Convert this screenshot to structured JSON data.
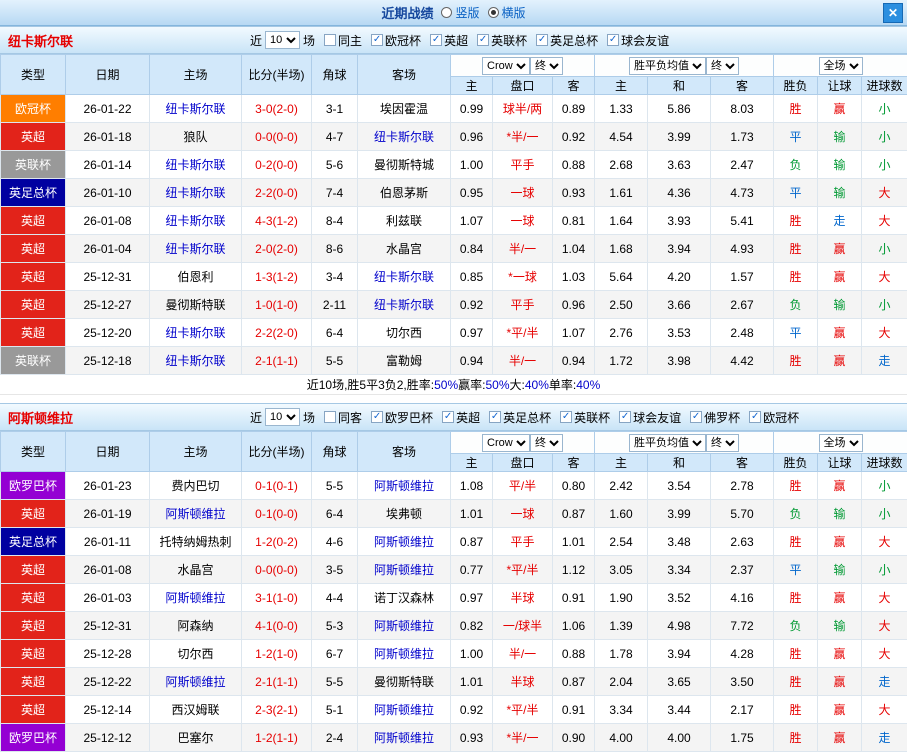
{
  "titlebar": {
    "title": "近期战绩",
    "radios": [
      {
        "label": "竖版",
        "selected": false
      },
      {
        "label": "横版",
        "selected": true
      }
    ],
    "close_label": "✕"
  },
  "header_labels": {
    "type": "类型",
    "date": "日期",
    "home": "主场",
    "score_half": "比分(半场)",
    "corner": "角球",
    "away": "客场",
    "h": "主",
    "handicap": "盘口",
    "a": "客",
    "win": "主",
    "draw": "和",
    "lose": "客",
    "result": "胜负",
    "let": "让球",
    "goals": "进球数"
  },
  "selects": {
    "company": "Crow",
    "final1": "终",
    "avg": "胜平负均值",
    "final2": "终",
    "full": "全场"
  },
  "filter_labels": {
    "near": "近",
    "games": "场"
  },
  "type_colors": {
    "欧冠杯": "#ff7e00",
    "英超": "#e2231a",
    "英联杯": "#999999",
    "英足总杯": "#0000a0",
    "欧罗巴杯": "#9400d3"
  },
  "result_colors": {
    "red": "#e60000",
    "green": "#009933",
    "blue": "#0066cc"
  },
  "result_color_map": {
    "胜": "red",
    "赢": "red",
    "大": "red",
    "负": "green",
    "输": "green",
    "小": "green",
    "平": "blue",
    "走": "blue"
  },
  "sections": [
    {
      "team": "纽卡斯尔联",
      "count": "10",
      "checkboxes": [
        {
          "label": "同主",
          "checked": false
        },
        {
          "label": "欧冠杯",
          "checked": true
        },
        {
          "label": "英超",
          "checked": true
        },
        {
          "label": "英联杯",
          "checked": true
        },
        {
          "label": "英足总杯",
          "checked": true
        },
        {
          "label": "球会友谊",
          "checked": true
        }
      ],
      "rows": [
        {
          "type": "欧冠杯",
          "date": "26-01-22",
          "home": "纽卡斯尔联",
          "score": "3-0(2-0)",
          "corner": "3-1",
          "away": "埃因霍温",
          "oh": "0.99",
          "hc": "球半/两",
          "oa": "0.89",
          "w": "1.33",
          "d": "5.86",
          "l": "8.03",
          "r": "胜",
          "g": "赢",
          "t": "小"
        },
        {
          "type": "英超",
          "date": "26-01-18",
          "home": "狼队",
          "score": "0-0(0-0)",
          "corner": "4-7",
          "away": "纽卡斯尔联",
          "oh": "0.96",
          "hc": "*半/一",
          "oa": "0.92",
          "w": "4.54",
          "d": "3.99",
          "l": "1.73",
          "r": "平",
          "g": "输",
          "t": "小"
        },
        {
          "type": "英联杯",
          "date": "26-01-14",
          "home": "纽卡斯尔联",
          "score": "0-2(0-0)",
          "corner": "5-6",
          "away": "曼彻斯特城",
          "oh": "1.00",
          "hc": "平手",
          "oa": "0.88",
          "w": "2.68",
          "d": "3.63",
          "l": "2.47",
          "r": "负",
          "g": "输",
          "t": "小"
        },
        {
          "type": "英足总杯",
          "date": "26-01-10",
          "home": "纽卡斯尔联",
          "score": "2-2(0-0)",
          "corner": "7-4",
          "away": "伯恩茅斯",
          "oh": "0.95",
          "hc": "一球",
          "oa": "0.93",
          "w": "1.61",
          "d": "4.36",
          "l": "4.73",
          "r": "平",
          "g": "输",
          "t": "大"
        },
        {
          "type": "英超",
          "date": "26-01-08",
          "home": "纽卡斯尔联",
          "score": "4-3(1-2)",
          "corner": "8-4",
          "away": "利兹联",
          "oh": "1.07",
          "hc": "一球",
          "oa": "0.81",
          "w": "1.64",
          "d": "3.93",
          "l": "5.41",
          "r": "胜",
          "g": "走",
          "t": "大"
        },
        {
          "type": "英超",
          "date": "26-01-04",
          "home": "纽卡斯尔联",
          "score": "2-0(2-0)",
          "corner": "8-6",
          "away": "水晶宫",
          "oh": "0.84",
          "hc": "半/一",
          "oa": "1.04",
          "w": "1.68",
          "d": "3.94",
          "l": "4.93",
          "r": "胜",
          "g": "赢",
          "t": "小"
        },
        {
          "type": "英超",
          "date": "25-12-31",
          "home": "伯恩利",
          "score": "1-3(1-2)",
          "corner": "3-4",
          "away": "纽卡斯尔联",
          "oh": "0.85",
          "hc": "*一球",
          "oa": "1.03",
          "w": "5.64",
          "d": "4.20",
          "l": "1.57",
          "r": "胜",
          "g": "赢",
          "t": "大"
        },
        {
          "type": "英超",
          "date": "25-12-27",
          "home": "曼彻斯特联",
          "score": "1-0(1-0)",
          "corner": "2-11",
          "away": "纽卡斯尔联",
          "oh": "0.92",
          "hc": "平手",
          "oa": "0.96",
          "w": "2.50",
          "d": "3.66",
          "l": "2.67",
          "r": "负",
          "g": "输",
          "t": "小"
        },
        {
          "type": "英超",
          "date": "25-12-20",
          "home": "纽卡斯尔联",
          "score": "2-2(2-0)",
          "corner": "6-4",
          "away": "切尔西",
          "oh": "0.97",
          "hc": "*平/半",
          "oa": "1.07",
          "w": "2.76",
          "d": "3.53",
          "l": "2.48",
          "r": "平",
          "g": "赢",
          "t": "大"
        },
        {
          "type": "英联杯",
          "date": "25-12-18",
          "home": "纽卡斯尔联",
          "score": "2-1(1-1)",
          "corner": "5-5",
          "away": "富勒姆",
          "oh": "0.94",
          "hc": "半/一",
          "oa": "0.94",
          "w": "1.72",
          "d": "3.98",
          "l": "4.42",
          "r": "胜",
          "g": "赢",
          "t": "走"
        }
      ],
      "summary": [
        {
          "text": "近10场,胜5平3负2, ",
          "color": "#000000"
        },
        {
          "text": "胜率:",
          "color": "#000000"
        },
        {
          "text": "50%",
          "color": "#0000cc"
        },
        {
          "text": " 赢率:",
          "color": "#000000"
        },
        {
          "text": "50%",
          "color": "#0000cc"
        },
        {
          "text": " 大:",
          "color": "#000000"
        },
        {
          "text": "40%",
          "color": "#0000cc"
        },
        {
          "text": " 单率:",
          "color": "#000000"
        },
        {
          "text": "40%",
          "color": "#0000cc"
        }
      ]
    },
    {
      "team": "阿斯顿维拉",
      "count": "10",
      "checkboxes": [
        {
          "label": "同客",
          "checked": false
        },
        {
          "label": "欧罗巴杯",
          "checked": true
        },
        {
          "label": "英超",
          "checked": true
        },
        {
          "label": "英足总杯",
          "checked": true
        },
        {
          "label": "英联杯",
          "checked": true
        },
        {
          "label": "球会友谊",
          "checked": true
        },
        {
          "label": "佛罗杯",
          "checked": true
        },
        {
          "label": "欧冠杯",
          "checked": true
        }
      ],
      "rows": [
        {
          "type": "欧罗巴杯",
          "date": "26-01-23",
          "home": "费内巴切",
          "score": "0-1(0-1)",
          "corner": "5-5",
          "away": "阿斯顿维拉",
          "oh": "1.08",
          "hc": "平/半",
          "oa": "0.80",
          "w": "2.42",
          "d": "3.54",
          "l": "2.78",
          "r": "胜",
          "g": "赢",
          "t": "小"
        },
        {
          "type": "英超",
          "date": "26-01-19",
          "home": "阿斯顿维拉",
          "score": "0-1(0-0)",
          "corner": "6-4",
          "away": "埃弗顿",
          "oh": "1.01",
          "hc": "一球",
          "oa": "0.87",
          "w": "1.60",
          "d": "3.99",
          "l": "5.70",
          "r": "负",
          "g": "输",
          "t": "小"
        },
        {
          "type": "英足总杯",
          "date": "26-01-11",
          "home": "托特纳姆热刺",
          "score": "1-2(0-2)",
          "corner": "4-6",
          "away": "阿斯顿维拉",
          "oh": "0.87",
          "hc": "平手",
          "oa": "1.01",
          "w": "2.54",
          "d": "3.48",
          "l": "2.63",
          "r": "胜",
          "g": "赢",
          "t": "大"
        },
        {
          "type": "英超",
          "date": "26-01-08",
          "home": "水晶宫",
          "score": "0-0(0-0)",
          "corner": "3-5",
          "away": "阿斯顿维拉",
          "oh": "0.77",
          "hc": "*平/半",
          "oa": "1.12",
          "w": "3.05",
          "d": "3.34",
          "l": "2.37",
          "r": "平",
          "g": "输",
          "t": "小"
        },
        {
          "type": "英超",
          "date": "26-01-03",
          "home": "阿斯顿维拉",
          "score": "3-1(1-0)",
          "corner": "4-4",
          "away": "诺丁汉森林",
          "oh": "0.97",
          "hc": "半球",
          "oa": "0.91",
          "w": "1.90",
          "d": "3.52",
          "l": "4.16",
          "r": "胜",
          "g": "赢",
          "t": "大"
        },
        {
          "type": "英超",
          "date": "25-12-31",
          "home": "阿森纳",
          "score": "4-1(0-0)",
          "corner": "5-3",
          "away": "阿斯顿维拉",
          "oh": "0.82",
          "hc": "一/球半",
          "oa": "1.06",
          "w": "1.39",
          "d": "4.98",
          "l": "7.72",
          "r": "负",
          "g": "输",
          "t": "大"
        },
        {
          "type": "英超",
          "date": "25-12-28",
          "home": "切尔西",
          "score": "1-2(1-0)",
          "corner": "6-7",
          "away": "阿斯顿维拉",
          "oh": "1.00",
          "hc": "半/一",
          "oa": "0.88",
          "w": "1.78",
          "d": "3.94",
          "l": "4.28",
          "r": "胜",
          "g": "赢",
          "t": "大"
        },
        {
          "type": "英超",
          "date": "25-12-22",
          "home": "阿斯顿维拉",
          "score": "2-1(1-1)",
          "corner": "5-5",
          "away": "曼彻斯特联",
          "oh": "1.01",
          "hc": "半球",
          "oa": "0.87",
          "w": "2.04",
          "d": "3.65",
          "l": "3.50",
          "r": "胜",
          "g": "赢",
          "t": "走"
        },
        {
          "type": "英超",
          "date": "25-12-14",
          "home": "西汉姆联",
          "score": "2-3(2-1)",
          "corner": "5-1",
          "away": "阿斯顿维拉",
          "oh": "0.92",
          "hc": "*平/半",
          "oa": "0.91",
          "w": "3.34",
          "d": "3.44",
          "l": "2.17",
          "r": "胜",
          "g": "赢",
          "t": "大"
        },
        {
          "type": "欧罗巴杯",
          "date": "25-12-12",
          "home": "巴塞尔",
          "score": "1-2(1-1)",
          "corner": "2-4",
          "away": "阿斯顿维拉",
          "oh": "0.93",
          "hc": "*半/一",
          "oa": "0.90",
          "w": "4.00",
          "d": "4.00",
          "l": "1.75",
          "r": "胜",
          "g": "赢",
          "t": "走"
        }
      ],
      "summary": []
    }
  ]
}
